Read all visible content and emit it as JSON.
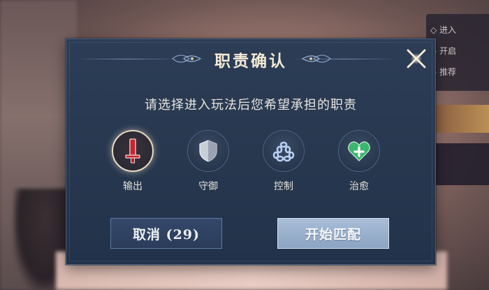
{
  "dialog": {
    "title": "职责确认",
    "subtitle": "请选择进入玩法后您希望承担的职责",
    "close_icon": "close-x-icon"
  },
  "roles": [
    {
      "label": "输出",
      "icon": "sword-icon",
      "color": "#d2303a",
      "selected": true
    },
    {
      "label": "守御",
      "icon": "shield-icon",
      "color": "#c9cfd8",
      "selected": false
    },
    {
      "label": "控制",
      "icon": "chain-triangle-icon",
      "color": "#aec8f0",
      "selected": false
    },
    {
      "label": "治愈",
      "icon": "heal-heart-icon",
      "color": "#3fb872",
      "selected": false
    }
  ],
  "buttons": {
    "cancel_label": "取消 (29)",
    "start_label": "开始匹配"
  },
  "background": {
    "right_panel_lines": [
      "◇ 进入",
      "◇ 开启",
      "◇ 推荐"
    ]
  },
  "colors": {
    "dialog_bg": "#27384f",
    "accent_gold": "#e9dcc2",
    "start_button": "#9fb4cf"
  }
}
